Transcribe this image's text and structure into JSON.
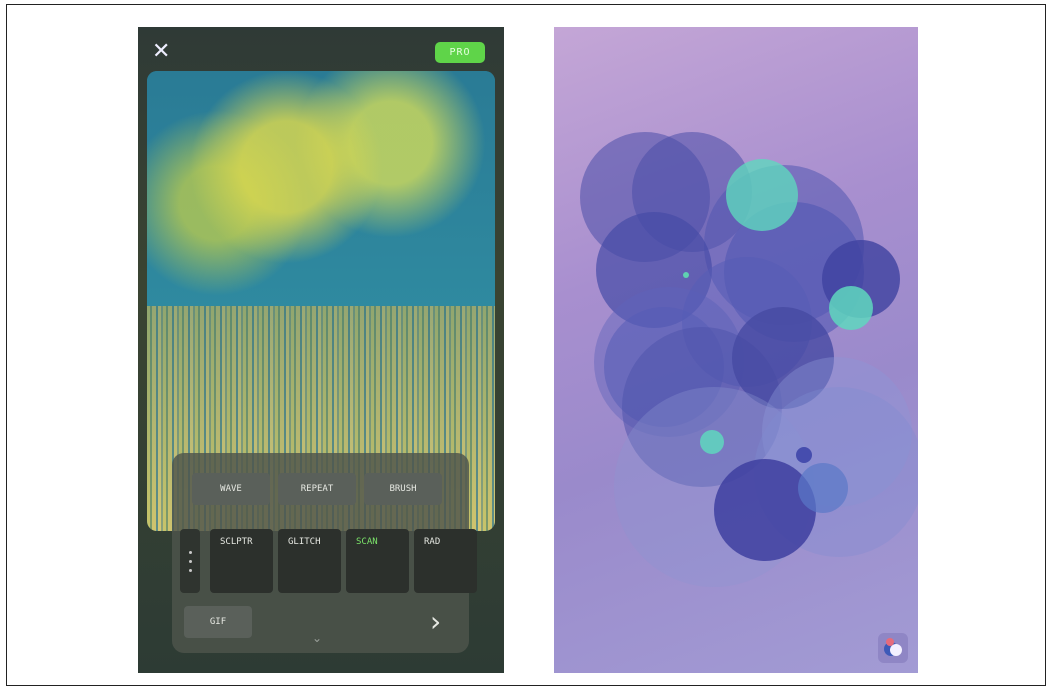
{
  "left_app": {
    "close_icon": "close-icon",
    "pro_badge": "PRO",
    "tool_row_1": [
      "WAVE",
      "REPEAT",
      "BRUSH"
    ],
    "modes": [
      {
        "label": "SCLPTR",
        "active": false
      },
      {
        "label": "GLITCH",
        "active": false
      },
      {
        "label": "SCAN",
        "active": true
      },
      {
        "label": "RAD",
        "active": false
      }
    ],
    "gif_label": "GIF",
    "next_icon": "chevron-right-icon",
    "collapse_icon": "chevron-down-icon",
    "accent_color": "#5fd449",
    "active_color": "#7be36a"
  },
  "right_app": {
    "circle_colors": [
      "#4b4fa8",
      "#5d62b8",
      "#6a6fc3",
      "#7b8bd0",
      "#5fd1b1"
    ],
    "corner_icon": "app-logo-icon"
  }
}
